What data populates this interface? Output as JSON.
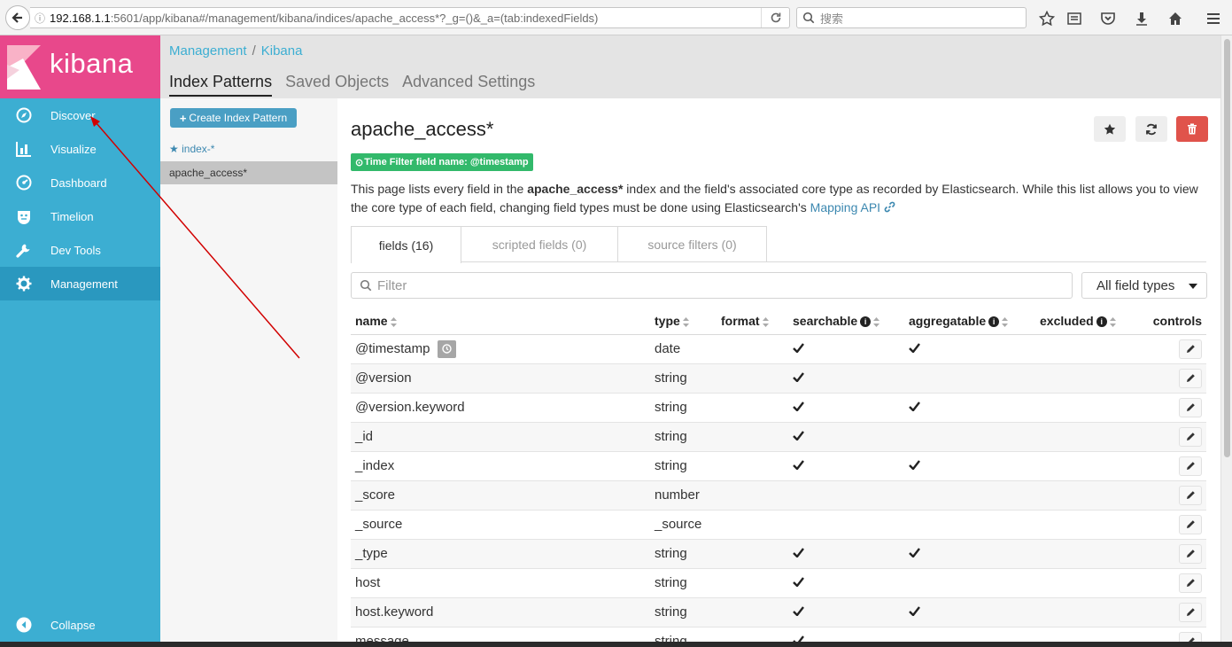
{
  "browser": {
    "url_host": "192.168.1.1",
    "url_rest": ":5601/app/kibana#/management/kibana/indices/apache_access*?_g=()&_a=(tab:indexedFields)",
    "search_placeholder": "搜索"
  },
  "sidebar": {
    "logo_text": "kibana",
    "items": [
      {
        "label": "Discover",
        "icon": "compass-icon"
      },
      {
        "label": "Visualize",
        "icon": "bar-chart-icon"
      },
      {
        "label": "Dashboard",
        "icon": "dashboard-icon"
      },
      {
        "label": "Timelion",
        "icon": "timelion-icon"
      },
      {
        "label": "Dev Tools",
        "icon": "wrench-icon"
      },
      {
        "label": "Management",
        "icon": "gear-icon"
      }
    ],
    "active": "Management",
    "collapse_label": "Collapse"
  },
  "breadcrumb": {
    "first": "Management",
    "separator": "/",
    "second": "Kibana"
  },
  "top_tabs": [
    {
      "label": "Index Patterns",
      "active": true
    },
    {
      "label": "Saved Objects",
      "active": false
    },
    {
      "label": "Advanced Settings",
      "active": false
    }
  ],
  "index_list": {
    "create_label": "Create Index Pattern",
    "default_pattern": "index-*",
    "selected_pattern": "apache_access*"
  },
  "main": {
    "title": "apache_access*",
    "time_filter_badge": "Time Filter field name: @timestamp",
    "desc_before": "This page lists every field in the ",
    "desc_bold": "apache_access*",
    "desc_after": " index and the field's associated core type as recorded by Elasticsearch. While this list allows you to view the core type of each field, changing field types must be done using Elasticsearch's ",
    "desc_link": "Mapping API",
    "tabs": [
      "fields (16)",
      "scripted fields (0)",
      "source filters (0)"
    ],
    "filter_placeholder": "Filter",
    "type_select": "All field types",
    "columns": {
      "name": "name",
      "type": "type",
      "format": "format",
      "searchable": "searchable",
      "aggregatable": "aggregatable",
      "excluded": "excluded",
      "controls": "controls"
    },
    "rows": [
      {
        "name": "@timestamp",
        "type": "date",
        "searchable": true,
        "aggregatable": true,
        "time_field": true
      },
      {
        "name": "@version",
        "type": "string",
        "searchable": true,
        "aggregatable": false
      },
      {
        "name": "@version.keyword",
        "type": "string",
        "searchable": true,
        "aggregatable": true
      },
      {
        "name": "_id",
        "type": "string",
        "searchable": true,
        "aggregatable": false
      },
      {
        "name": "_index",
        "type": "string",
        "searchable": true,
        "aggregatable": true
      },
      {
        "name": "_score",
        "type": "number",
        "searchable": false,
        "aggregatable": false
      },
      {
        "name": "_source",
        "type": "_source",
        "searchable": false,
        "aggregatable": false
      },
      {
        "name": "_type",
        "type": "string",
        "searchable": true,
        "aggregatable": true
      },
      {
        "name": "host",
        "type": "string",
        "searchable": true,
        "aggregatable": false
      },
      {
        "name": "host.keyword",
        "type": "string",
        "searchable": true,
        "aggregatable": true
      },
      {
        "name": "message",
        "type": "string",
        "searchable": true,
        "aggregatable": false
      }
    ]
  },
  "colors": {
    "sidebar": "#3caed2",
    "sidebar_active": "#2a98bf",
    "logo_bg": "#e8488b",
    "badge_green": "#32b96b",
    "delete_red": "#e0534b",
    "annotation_arrow": "#d10000"
  }
}
